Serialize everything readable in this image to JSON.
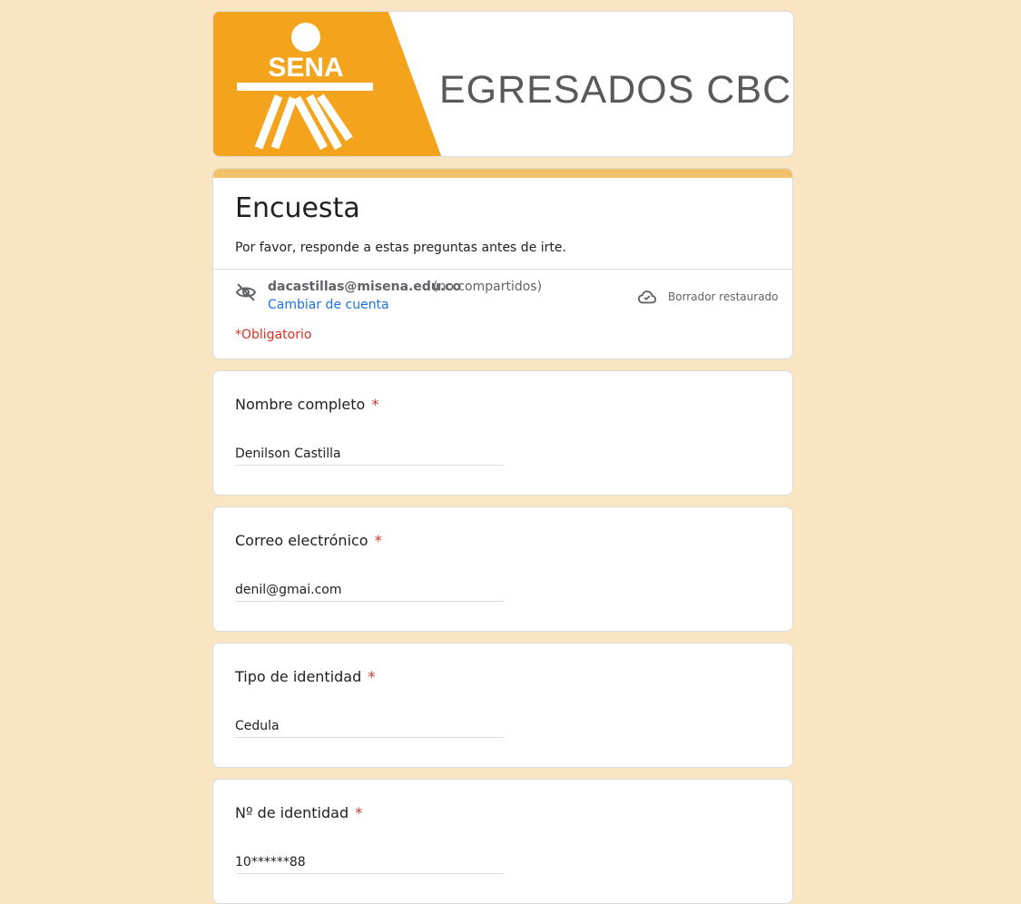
{
  "banner": {
    "logo_text": "SENA",
    "title": "EGRESADOS CBC",
    "colors": {
      "orange": "#f4a31c",
      "title_gray": "#58595b"
    }
  },
  "header": {
    "title": "Encuesta",
    "description": "Por favor, responde a estas preguntas antes de irte.",
    "account_email": "dacastillas@misena.edu.co",
    "account_note": "(no compartidos)",
    "switch_account": "Cambiar de cuenta",
    "draft_status": "Borrador restaurado",
    "required_note": "*Obligatorio",
    "icons": [
      "eye-off-icon",
      "cloud-check-icon"
    ]
  },
  "questions": [
    {
      "label": "Nombre completo",
      "required_mark": "*",
      "value": "Denilson Castilla"
    },
    {
      "label": "Correo electrónico",
      "required_mark": "*",
      "value": "denil@gmai.com"
    },
    {
      "label": "Tipo de identidad",
      "required_mark": "*",
      "value": "Cedula"
    },
    {
      "label": "Nº de identidad",
      "required_mark": "*",
      "value": "10******88"
    }
  ],
  "theme": {
    "page_background": "#fae5c2",
    "accent": "#f2c16a",
    "link": "#1a73e8",
    "required": "#d93025"
  }
}
